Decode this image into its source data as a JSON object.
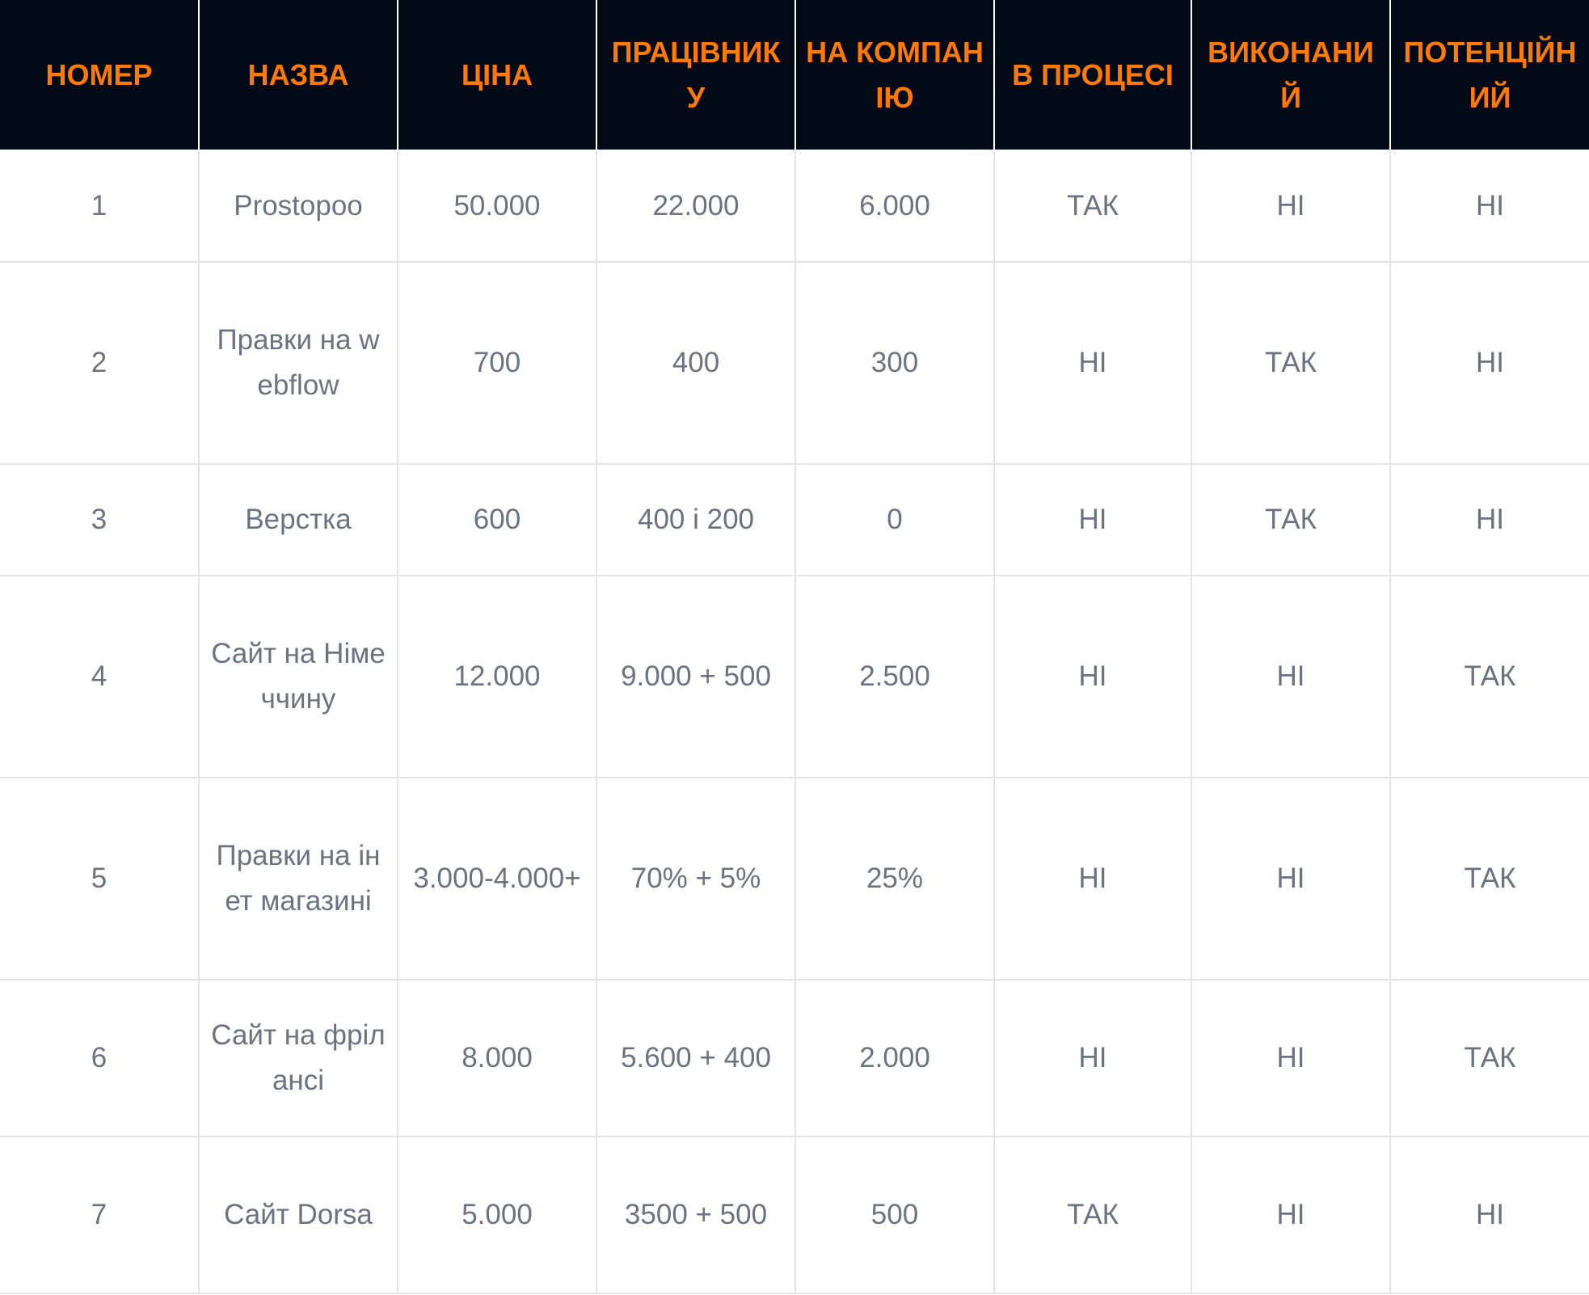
{
  "table": {
    "headers": [
      "НОМЕР",
      "НАЗВА",
      "ЦІНА",
      "ПРАЦІВНИКУ",
      "НА КОМПАНІЮ",
      "В ПРОЦЕСІ",
      "ВИКОНАНИЙ",
      "ПОТЕНЦІЙНИЙ"
    ],
    "rows": [
      [
        "1",
        "Prostopoo",
        "50.000",
        "22.000",
        "6.000",
        "ТАК",
        "НІ",
        "НІ"
      ],
      [
        "2",
        "Правки на webflow",
        "700",
        "400",
        "300",
        "НІ",
        "ТАК",
        "НІ"
      ],
      [
        "3",
        "Верстка",
        "600",
        "400 і 200",
        "0",
        "НІ",
        "ТАК",
        "НІ"
      ],
      [
        "4",
        "Сайт на Німеччину",
        "12.000",
        "9.000 + 500",
        "2.500",
        "НІ",
        "НІ",
        "ТАК"
      ],
      [
        "5",
        "Правки на інет магазині",
        "3.000-4.000+",
        "70% + 5%",
        "25%",
        "НІ",
        "НІ",
        "ТАК"
      ],
      [
        "6",
        "Сайт на фрілансі",
        "8.000",
        "5.600 + 400",
        "2.000",
        "НІ",
        "НІ",
        "ТАК"
      ],
      [
        "7",
        "Сайт Dorsa",
        "5.000",
        "3500 + 500",
        "500",
        "ТАК",
        "НІ",
        "НІ"
      ]
    ]
  },
  "colors": {
    "header_background": "#020a18",
    "header_text": "#ff7a05",
    "cell_text": "#6b7280",
    "grid_line": "#e5e5e5"
  }
}
